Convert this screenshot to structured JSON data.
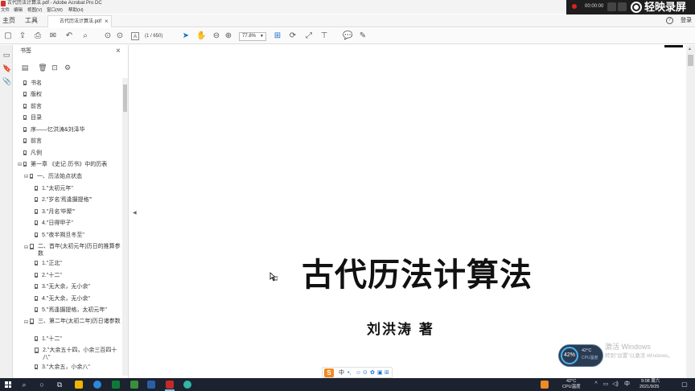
{
  "window": {
    "title": "古代历法计算法.pdf - Adobe Acrobat Pro DC"
  },
  "menu": {
    "items": [
      "文件",
      "编辑",
      "视图(V)",
      "窗口(W)",
      "帮助(H)"
    ]
  },
  "recorder": {
    "elapsed": "00:00:00",
    "brand": "轻映录屏"
  },
  "tabs": {
    "home": "主页",
    "tools": "工具",
    "document": "古代历法计算法.pdf",
    "login": "登录",
    "help": "?"
  },
  "toolbar": {
    "page_indicator": "(1 / 650)",
    "page_input": "A",
    "zoom": "77.8%"
  },
  "bookmarks_panel": {
    "title": "书签",
    "items": [
      {
        "label": "书名"
      },
      {
        "label": "版权"
      },
      {
        "label": "前言"
      },
      {
        "label": "目录"
      },
      {
        "label": "序——忆洪涛&刘泽华"
      },
      {
        "label": "前言"
      },
      {
        "label": "凡例"
      },
      {
        "label": "第一章 《史记·历书》中的历表"
      },
      {
        "label": "一、历法始点状态"
      },
      {
        "label": "1.\"太初元年\""
      },
      {
        "label": "2.\"岁名'焉逢摄提格'\""
      },
      {
        "label": "3.\"月名'毕聚'\""
      },
      {
        "label": "4.\"日得甲子\""
      },
      {
        "label": "5.\"夜半朔旦冬至\""
      },
      {
        "label": "二、首年(太初元年)历日的推算参数"
      },
      {
        "label": "1.\"正北\""
      },
      {
        "label": "2.\"十二\""
      },
      {
        "label": "3.\"无大余，无小余\""
      },
      {
        "label": "4.\"无大余，无小余\""
      },
      {
        "label": "5.\"焉逢摄提格，太初元年\""
      },
      {
        "label": "三、第二年(太初二年)历日诸参数"
      },
      {
        "label": "1.\"十二\""
      },
      {
        "label": "2.\"大余五十四，小余三百四十八\""
      },
      {
        "label": "3.\"大余五，小余八\""
      }
    ]
  },
  "document": {
    "title": "古代历法计算法",
    "author": "刘洪涛  著"
  },
  "overlay": {
    "cpu_percent": "42%",
    "cpu_temp": "42°C",
    "cpu_label": "CPU温度",
    "watermark_line1": "激活 Windows",
    "watermark_line2": "转到\"设置\"以激活 Windows。"
  },
  "ime": {
    "logo": "S",
    "mode": "中"
  },
  "taskbar": {
    "temperature": "42°C",
    "temp_label": "CPU温度",
    "time": "9:08 周六",
    "date": "2021/9/25",
    "lang": "中"
  }
}
